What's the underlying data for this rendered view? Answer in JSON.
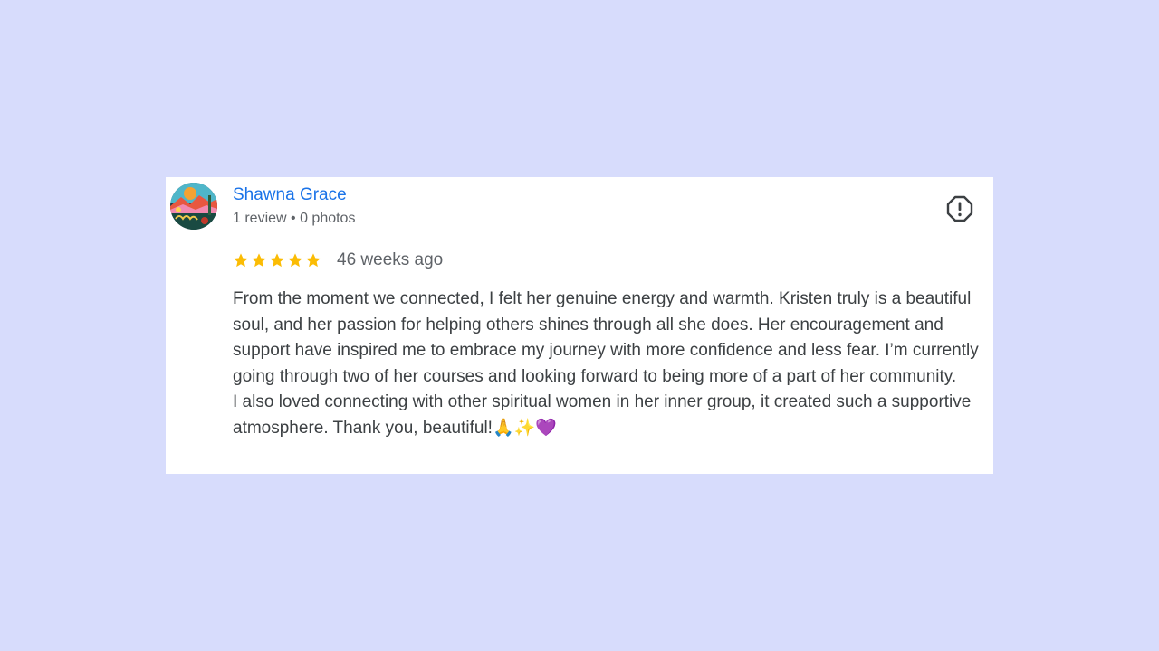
{
  "reviewer": {
    "name": "Shawna Grace",
    "meta": "1 review • 0 photos"
  },
  "review": {
    "rating": 5,
    "max_rating": 5,
    "date": "46 weeks ago",
    "paragraphs": [
      "From the moment we connected, I felt her genuine energy and warmth. Kristen truly is a beautiful soul, and her passion for helping others shines through all she does. Her encouragement and support have inspired me to embrace my journey with more confidence and less fear. I’m currently going through two of her courses and looking forward to being more of a part of her community.",
      "I also loved connecting with other spiritual women in her inner group, it created such a supportive atmosphere. Thank you, beautiful!🙏✨💜"
    ]
  },
  "icons": {
    "report": "report-flag-icon",
    "star": "star-icon"
  },
  "colors": {
    "background": "#d7dcfc",
    "card": "#ffffff",
    "name": "#1a73e8",
    "star": "#fbbc04",
    "text": "#3c4043",
    "meta": "#5f6368"
  }
}
